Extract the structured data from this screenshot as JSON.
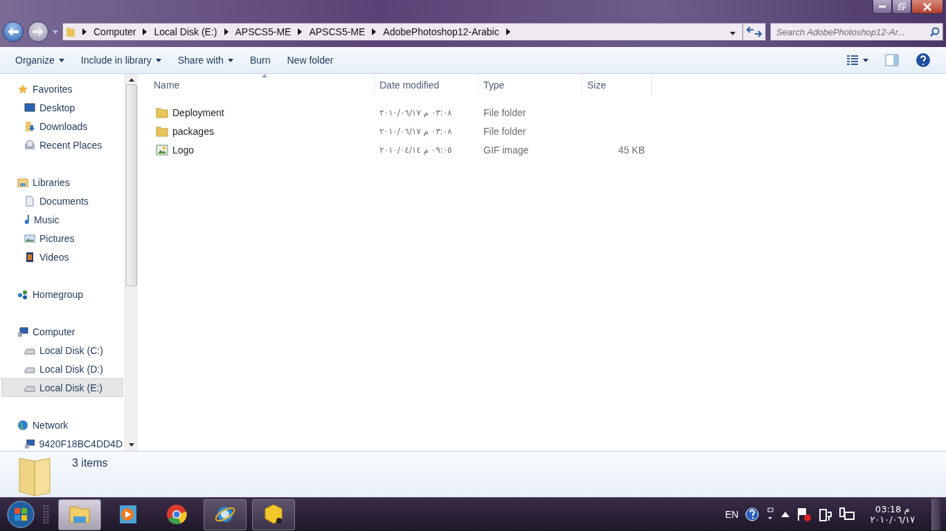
{
  "navigation": {
    "breadcrumbs": [
      "Computer",
      "Local Disk (E:)",
      "APSCS5-ME",
      "APSCS5-ME",
      "AdobePhotoshop12-Arabic"
    ],
    "search": {
      "placeholder": "Search AdobePhotoshop12-Ar..."
    }
  },
  "toolbar": [
    {
      "label": "Organize",
      "dropdown": true
    },
    {
      "label": "Include in library",
      "dropdown": true
    },
    {
      "label": "Share with",
      "dropdown": true
    },
    {
      "label": "Burn",
      "dropdown": false
    },
    {
      "label": "New folder",
      "dropdown": false
    }
  ],
  "sidebar": {
    "groups": [
      {
        "label": "Favorites",
        "kind": "star",
        "children": [
          {
            "label": "Desktop",
            "kind": "desktop",
            "selected": false
          },
          {
            "label": "Downloads",
            "kind": "download",
            "selected": false
          },
          {
            "label": "Recent Places",
            "kind": "recent",
            "selected": false
          }
        ]
      },
      {
        "label": "Libraries",
        "kind": "library",
        "children": [
          {
            "label": "Documents",
            "kind": "document",
            "selected": false
          },
          {
            "label": "Music",
            "kind": "music",
            "selected": false
          },
          {
            "label": "Pictures",
            "kind": "picture",
            "selected": false
          },
          {
            "label": "Videos",
            "kind": "video",
            "selected": false
          }
        ]
      },
      {
        "label": "Homegroup",
        "kind": "homegroup"
      },
      {
        "label": "Computer",
        "kind": "computer",
        "children": [
          {
            "label": "Local Disk (C:)",
            "kind": "drive",
            "selected": false
          },
          {
            "label": "Local Disk (D:)",
            "kind": "drive",
            "selected": false
          },
          {
            "label": "Local Disk (E:)",
            "kind": "drive",
            "selected": true
          }
        ]
      },
      {
        "label": "Network",
        "kind": "network",
        "children": [
          {
            "label": "9420F18BC4DD4D",
            "kind": "computer",
            "selected": false
          }
        ]
      }
    ]
  },
  "table": {
    "columns": [
      {
        "label": "Name",
        "sorted": true
      },
      {
        "label": "Date modified",
        "sorted": false
      },
      {
        "label": "Type",
        "sorted": false
      },
      {
        "label": "Size",
        "sorted": false
      }
    ],
    "rows": [
      {
        "kind": "folder",
        "name": "Deployment",
        "date": "٢٠١٠/٠٦/١٧ م ٠٣:٠٨",
        "type": "File folder"
      },
      {
        "kind": "folder",
        "name": "packages",
        "date": "٢٠١٠/٠٦/١٧ م ٠٣:٠٨",
        "type": "File folder"
      },
      {
        "kind": "image",
        "name": "Logo",
        "date": "٢٠١٠/٠٤/١٤ م ٠٩:٠٥",
        "type": "GIF image",
        "size": "45 KB"
      }
    ]
  },
  "details": {
    "count": "3 items"
  },
  "taskbar": {
    "apps": [
      {
        "kind": "explorer",
        "running": true,
        "active": true
      },
      {
        "kind": "media",
        "running": false,
        "active": false
      },
      {
        "kind": "chrome",
        "running": false,
        "active": false
      },
      {
        "kind": "ie",
        "running": true,
        "active": false
      },
      {
        "kind": "cube",
        "running": true,
        "active": false
      }
    ],
    "tray": {
      "language": "EN",
      "time": "03:18 م",
      "date": "٢٠١٠/٠٦/١٧"
    }
  }
}
